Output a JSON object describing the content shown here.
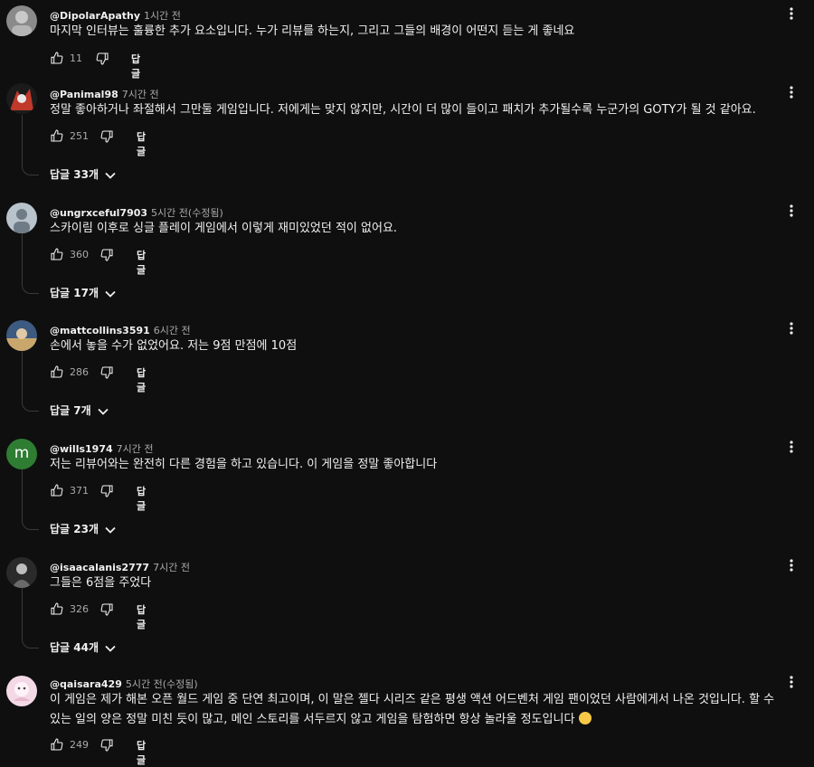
{
  "comments": [
    {
      "handle": "@DipolarApathy",
      "time": "1시간 전",
      "text": "마지막 인터뷰는 훌륭한 추가 요소입니다. 누가 리뷰를 하는지, 그리고 그들의 배경이 어떤지 듣는 게 좋네요",
      "likes": "11",
      "reply_label": "답글",
      "replies_label": ""
    },
    {
      "handle": "@Panimal98",
      "time": "7시간 전",
      "text": "정말 좋아하거나 좌절해서 그만둘 게임입니다. 저에게는 맞지 않지만, 시간이 더 많이 들이고 패치가 추가될수록 누군가의 GOTY가 될 것 같아요.",
      "likes": "251",
      "reply_label": "답글",
      "replies_label": "답글 33개"
    },
    {
      "handle": "@ungrxceful7903",
      "time": "5시간 전(수정됨)",
      "text": "스카이림 이후로 싱글 플레이 게임에서 이렇게 재미있었던 적이 없어요.",
      "likes": "360",
      "reply_label": "답글",
      "replies_label": "답글 17개"
    },
    {
      "handle": "@mattcollins3591",
      "time": "6시간 전",
      "text": "손에서 놓을 수가 없었어요. 저는 9점 만점에 10점",
      "likes": "286",
      "reply_label": "답글",
      "replies_label": "답글 7개"
    },
    {
      "handle": "@wills1974",
      "time": "7시간 전",
      "avatar_letter": "m",
      "text": "저는 리뷰어와는 완전히 다른 경험을 하고 있습니다. 이 게임을 정말 좋아합니다",
      "likes": "371",
      "reply_label": "답글",
      "replies_label": "답글 23개"
    },
    {
      "handle": "@isaacalanis2777",
      "time": "7시간 전",
      "text": "그들은 6점을 주었다",
      "likes": "326",
      "reply_label": "답글",
      "replies_label": "답글 44개"
    },
    {
      "handle": "@qaisara429",
      "time": "5시간 전(수정됨)",
      "text": "이 게임은 제가 해본 오픈 월드 게임 중 단연 최고이며, 이 말은 젤다 시리즈 같은 평생 액션 어드벤처 게임 팬이었던 사람에게서 나온 것입니다. 할 수 있는 일의 양은 정말 미친 듯이 많고, 메인 스토리를 서두르지 않고 게임을 탐험하면 항상 놀라울 정도입니다",
      "emoji": "smiling-face-emoji",
      "likes": "249",
      "reply_label": "답글",
      "replies_label": ""
    }
  ],
  "colors": {
    "background": "#0f0f0f",
    "text_primary": "#f1f1f1",
    "text_secondary": "#aaaaaa",
    "thread_line": "#3a3a3a",
    "avatar_m_bg": "#2e7d32"
  },
  "icons": [
    "like-icon",
    "dislike-icon",
    "more-vert-icon",
    "chevron-down-icon",
    "avatar-image"
  ]
}
